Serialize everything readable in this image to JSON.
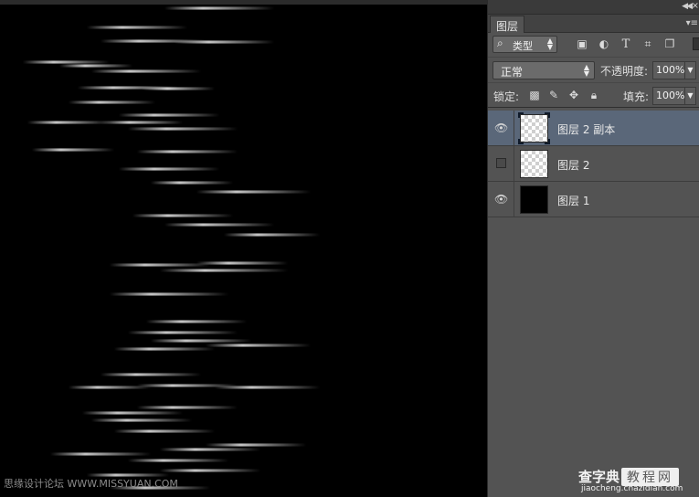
{
  "canvas": {
    "background": "#000000",
    "streak_color": "#ffffff",
    "watermark": "思缘设计论坛 WWW.MISSYUAN.COM"
  },
  "panel": {
    "tab_label": "图层",
    "filter_kind": "类型",
    "filter_icons": [
      "image-icon",
      "adjustment-icon",
      "type-icon",
      "shape-icon",
      "smart-object-icon"
    ],
    "blend_mode": "正常",
    "opacity_label": "不透明度:",
    "opacity_value": "100%",
    "lock_label": "锁定:",
    "lock_icons": [
      "lock-transparent-icon",
      "lock-paint-icon",
      "lock-position-icon",
      "lock-all-icon"
    ],
    "fill_label": "填充:",
    "fill_value": "100%",
    "layers": [
      {
        "name": "图层 2 副本",
        "visible": true,
        "selected": true,
        "thumbnail": "transparent"
      },
      {
        "name": "图层 2",
        "visible": false,
        "selected": false,
        "thumbnail": "transparent"
      },
      {
        "name": "图层 1",
        "visible": true,
        "selected": false,
        "thumbnail": "black"
      }
    ]
  },
  "site_watermark": {
    "brand": "查字典",
    "box": "教程网",
    "url": "jiaocheng.chazidian.com"
  }
}
